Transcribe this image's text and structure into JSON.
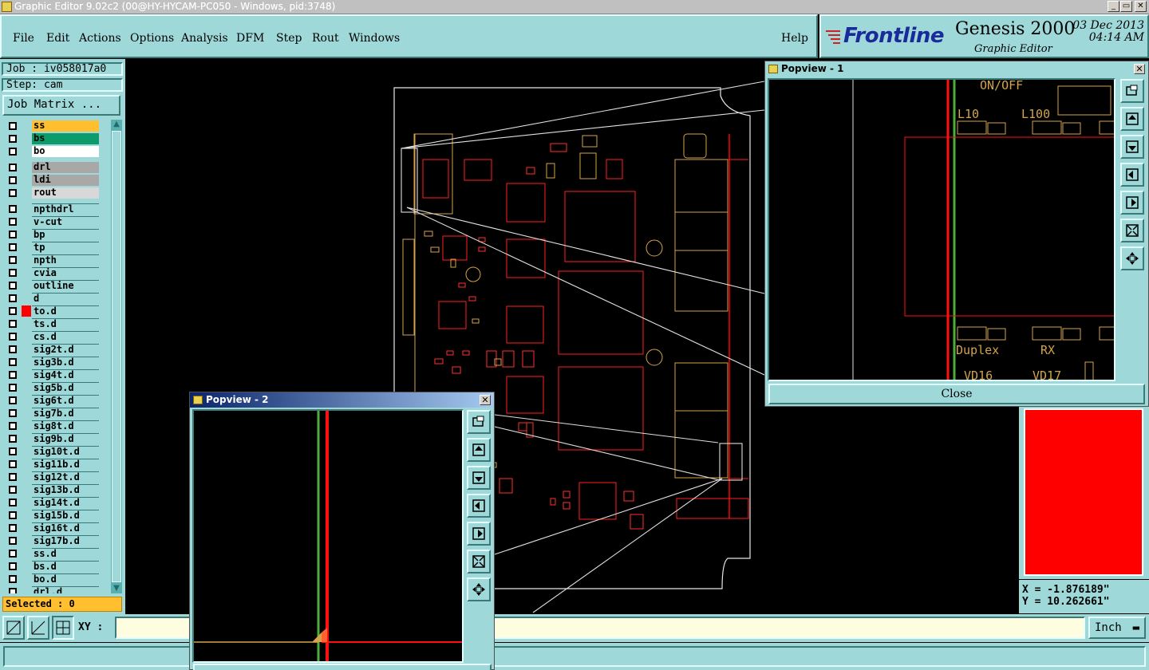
{
  "window": {
    "title": "Graphic Editor 9.02c2 (00@HY-HYCAM-PC050 - Windows, pid:3748)",
    "minimize": "_",
    "maximize": "▭",
    "close": "✕"
  },
  "menu": {
    "items": [
      {
        "label": "File"
      },
      {
        "label": "Edit"
      },
      {
        "label": "Actions"
      },
      {
        "label": "Options"
      },
      {
        "label": "Analysis"
      },
      {
        "label": "DFM"
      },
      {
        "label": "Step"
      },
      {
        "label": "Rout"
      },
      {
        "label": "Windows"
      }
    ],
    "help": "Help"
  },
  "brand": {
    "logo": "Frontline",
    "product": "Genesis 2000",
    "subtitle": "Graphic Editor",
    "date": "03 Dec 2013",
    "time": "04:14 AM"
  },
  "job": {
    "job_label": "Job : iv058017a0",
    "step_label": "Step: cam",
    "matrix_button": "Job Matrix ..."
  },
  "layers": [
    {
      "name": "ss",
      "color": "#ffbf2f",
      "group": 1
    },
    {
      "name": "bs",
      "color": "#0c9c6c",
      "group": 1
    },
    {
      "name": "bo",
      "color": "#ffffff",
      "group": 1
    },
    {
      "name": "drl",
      "color": "#a8a8a8",
      "group": 2
    },
    {
      "name": "ldi",
      "color": "#a8a8a8",
      "group": 2
    },
    {
      "name": "rout",
      "color": "#d8d8d8",
      "group": 2
    },
    {
      "name": "npthdrl",
      "color": "",
      "group": 3
    },
    {
      "name": "v-cut",
      "color": "",
      "group": 3
    },
    {
      "name": "bp",
      "color": "",
      "group": 3
    },
    {
      "name": "tp",
      "color": "",
      "group": 3
    },
    {
      "name": "npth",
      "color": "",
      "group": 3
    },
    {
      "name": "cvia",
      "color": "",
      "group": 3
    },
    {
      "name": "outline",
      "color": "",
      "group": 3
    },
    {
      "name": "d",
      "color": "",
      "group": 3
    },
    {
      "name": "to.d",
      "color": "",
      "group": 3,
      "mark": "#ff0000"
    },
    {
      "name": "ts.d",
      "color": "",
      "group": 3
    },
    {
      "name": "cs.d",
      "color": "",
      "group": 3
    },
    {
      "name": "sig2t.d",
      "color": "",
      "group": 3
    },
    {
      "name": "sig3b.d",
      "color": "",
      "group": 3
    },
    {
      "name": "sig4t.d",
      "color": "",
      "group": 3
    },
    {
      "name": "sig5b.d",
      "color": "",
      "group": 3
    },
    {
      "name": "sig6t.d",
      "color": "",
      "group": 3
    },
    {
      "name": "sig7b.d",
      "color": "",
      "group": 3
    },
    {
      "name": "sig8t.d",
      "color": "",
      "group": 3
    },
    {
      "name": "sig9b.d",
      "color": "",
      "group": 3
    },
    {
      "name": "sig10t.d",
      "color": "",
      "group": 3
    },
    {
      "name": "sig11b.d",
      "color": "",
      "group": 3
    },
    {
      "name": "sig12t.d",
      "color": "",
      "group": 3
    },
    {
      "name": "sig13b.d",
      "color": "",
      "group": 3
    },
    {
      "name": "sig14t.d",
      "color": "",
      "group": 3
    },
    {
      "name": "sig15b.d",
      "color": "",
      "group": 3
    },
    {
      "name": "sig16t.d",
      "color": "",
      "group": 3
    },
    {
      "name": "sig17b.d",
      "color": "",
      "group": 3
    },
    {
      "name": "ss.d",
      "color": "",
      "group": 3
    },
    {
      "name": "bs.d",
      "color": "",
      "group": 3
    },
    {
      "name": "bo.d",
      "color": "",
      "group": 3
    },
    {
      "name": "drl.d",
      "color": "",
      "group": 3
    }
  ],
  "selected": "Selected : 0",
  "xy": {
    "label": "XY :",
    "value": ""
  },
  "units": "Inch",
  "coords": {
    "x": "X = -1.876189\"",
    "y": "Y = 10.262661\""
  },
  "popview1": {
    "title": "Popview - 1",
    "close_button": "Close",
    "labels": [
      "ON/OFF",
      "L10",
      "L100",
      "Duplex",
      "RX",
      "VD16",
      "VD17"
    ]
  },
  "popview2": {
    "title": "Popview - 2"
  },
  "colors": {
    "panel": "#9ed8d8",
    "pcb_red": "#ff0000",
    "pcb_orange": "#d4a44c",
    "pcb_green": "#4cae3c"
  }
}
